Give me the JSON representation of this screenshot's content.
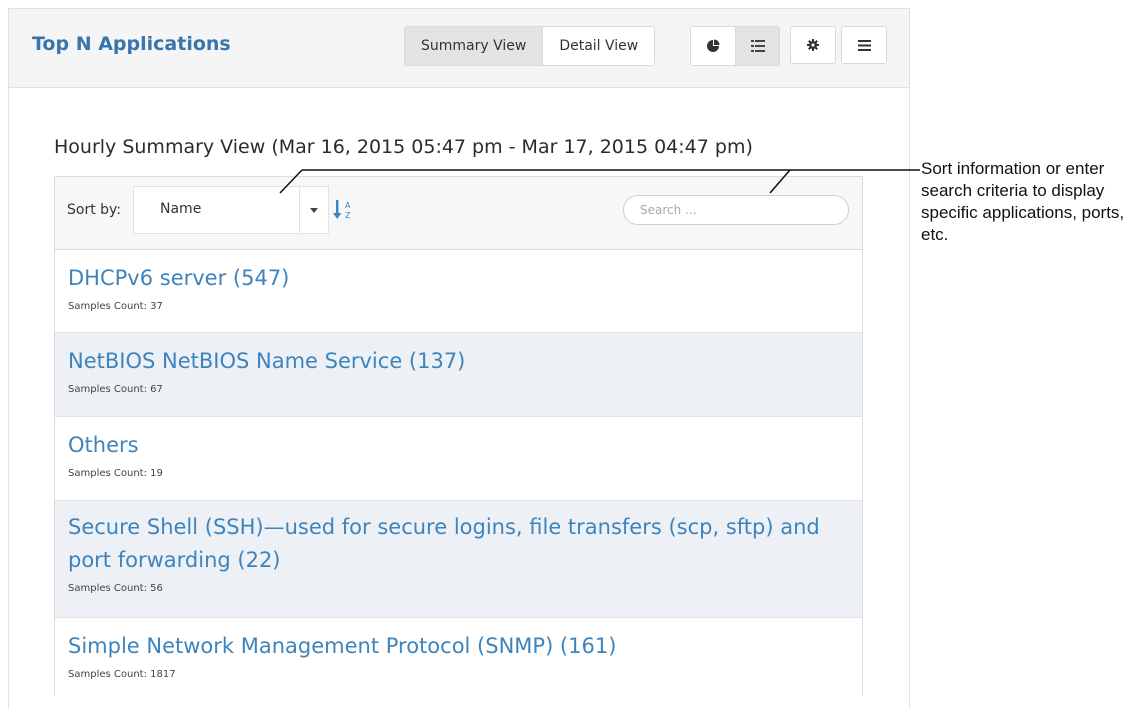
{
  "panel": {
    "title": "Top N Applications",
    "views": [
      {
        "label": "Summary View",
        "active": true
      },
      {
        "label": "Detail View",
        "active": false
      }
    ],
    "icons": [
      "pie-chart-icon",
      "list-icon",
      "gear-icon",
      "menu-icon"
    ]
  },
  "summary": {
    "heading": "Hourly Summary View (Mar 16, 2015 05:47 pm - Mar 17, 2015 04:47 pm)"
  },
  "toolbar": {
    "sort_label": "Sort by:",
    "sort_value": "Name",
    "search_placeholder": "Search ..."
  },
  "apps": [
    {
      "name": "DHCPv6 server (547)",
      "count": "Samples Count: 37"
    },
    {
      "name": "NetBIOS NetBIOS Name Service (137)",
      "count": "Samples Count: 67"
    },
    {
      "name": "Others",
      "count": "Samples Count: 19"
    },
    {
      "name": "Secure Shell (SSH)—used for secure logins, file transfers (scp, sftp) and port forwarding (22)",
      "count": "Samples Count: 56"
    },
    {
      "name": "Simple Network Management Protocol (SNMP) (161)",
      "count": "Samples Count: 1817"
    }
  ],
  "callout": {
    "text": "Sort information or enter search criteria to display specific applications, ports, etc."
  },
  "colors": {
    "title_blue": "#3a74ad",
    "link_blue": "#3d84bd",
    "alt_row": "#edf1f5"
  }
}
